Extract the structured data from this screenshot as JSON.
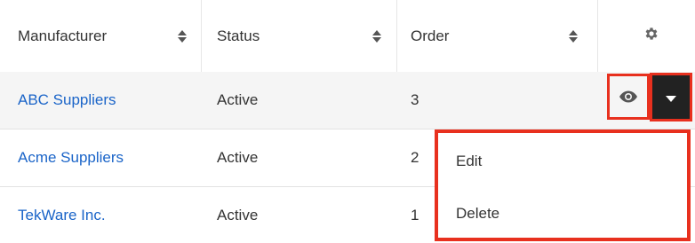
{
  "columns": {
    "manufacturer": "Manufacturer",
    "status": "Status",
    "order": "Order"
  },
  "rows": [
    {
      "manufacturer": "ABC Suppliers",
      "status": "Active",
      "order": "3"
    },
    {
      "manufacturer": "Acme Suppliers",
      "status": "Active",
      "order": "2"
    },
    {
      "manufacturer": "TekWare Inc.",
      "status": "Active",
      "order": "1"
    }
  ],
  "actions_menu": {
    "edit_label": "Edit",
    "delete_label": "Delete"
  },
  "icons": {
    "settings": "gear-icon",
    "preview": "eye-icon",
    "menu_toggle": "caret-down-icon",
    "sort": "sort-icon"
  },
  "colors": {
    "link": "#1a64c8",
    "highlight": "#e8301e",
    "caret_button": "#222222"
  }
}
